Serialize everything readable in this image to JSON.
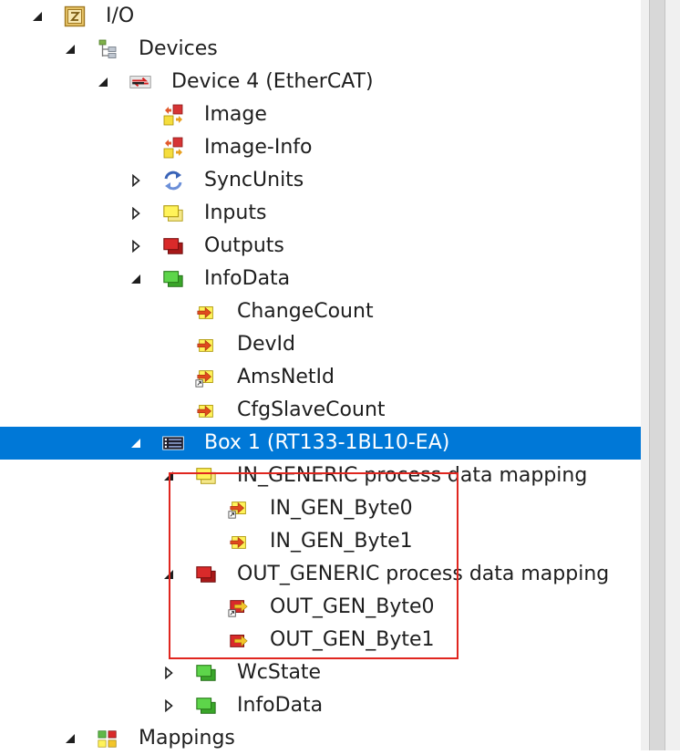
{
  "tree": {
    "items": [
      {
        "label": "I/O",
        "icon": "io-folder-icon",
        "expander": "open"
      },
      {
        "label": "Devices",
        "icon": "devices-icon",
        "expander": "open"
      },
      {
        "label": "Device 4 (EtherCAT)",
        "icon": "ethercat-device-icon",
        "expander": "open"
      },
      {
        "label": "Image",
        "icon": "image-icon",
        "expander": "none"
      },
      {
        "label": "Image-Info",
        "icon": "image-info-icon",
        "expander": "none"
      },
      {
        "label": "SyncUnits",
        "icon": "sync-units-icon",
        "expander": "closed"
      },
      {
        "label": "Inputs",
        "icon": "inputs-icon",
        "expander": "closed"
      },
      {
        "label": "Outputs",
        "icon": "outputs-icon",
        "expander": "closed"
      },
      {
        "label": "InfoData",
        "icon": "infodata-icon",
        "expander": "open"
      },
      {
        "label": "ChangeCount",
        "icon": "input-variable-icon",
        "expander": "none"
      },
      {
        "label": "DevId",
        "icon": "input-variable-icon",
        "expander": "none"
      },
      {
        "label": "AmsNetId",
        "icon": "linked-input-variable-icon",
        "expander": "none"
      },
      {
        "label": "CfgSlaveCount",
        "icon": "input-variable-icon",
        "expander": "none"
      },
      {
        "label": "Box 1 (RT133-1BL10-EA)",
        "icon": "box-icon",
        "expander": "open",
        "selected": true
      },
      {
        "label": "IN_GENERIC process data mapping",
        "icon": "inputs-icon",
        "expander": "open"
      },
      {
        "label": "IN_GEN_Byte0",
        "icon": "linked-input-variable-icon",
        "expander": "none"
      },
      {
        "label": "IN_GEN_Byte1",
        "icon": "input-variable-icon",
        "expander": "none"
      },
      {
        "label": "OUT_GENERIC process data mapping",
        "icon": "outputs-icon",
        "expander": "open"
      },
      {
        "label": "OUT_GEN_Byte0",
        "icon": "linked-output-variable-icon",
        "expander": "none"
      },
      {
        "label": "OUT_GEN_Byte1",
        "icon": "output-variable-icon",
        "expander": "none"
      },
      {
        "label": "WcState",
        "icon": "wcstate-icon",
        "expander": "closed"
      },
      {
        "label": "InfoData",
        "icon": "infodata-icon",
        "expander": "closed"
      },
      {
        "label": "Mappings",
        "icon": "mappings-icon",
        "expander": "open"
      }
    ]
  },
  "colors": {
    "selection": "#0078d7",
    "highlight_border": "#e0261f",
    "text": "#1e1e1e"
  }
}
